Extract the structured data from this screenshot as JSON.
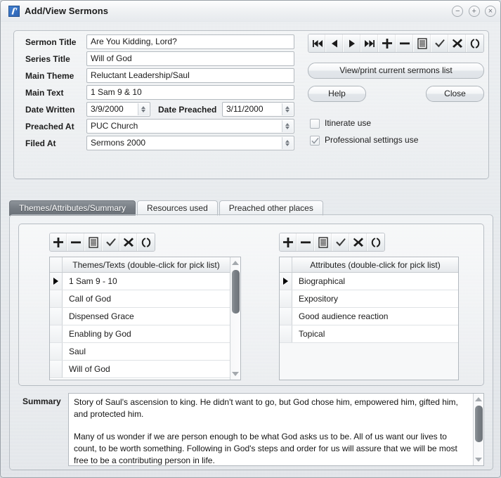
{
  "window": {
    "title": "Add/View Sermons",
    "app_icon": "sermon-app-icon",
    "controls": [
      {
        "name": "minimize-button",
        "glyph": "−"
      },
      {
        "name": "maximize-button",
        "glyph": "+"
      },
      {
        "name": "close-button",
        "glyph": "×"
      }
    ]
  },
  "form": {
    "fields": [
      {
        "label": "Sermon Title",
        "value": "Are You Kidding, Lord?"
      },
      {
        "label": "Series Title",
        "value": "Will of God"
      },
      {
        "label": "Main Theme",
        "value": "Reluctant Leadership/Saul"
      },
      {
        "label": "Main Text",
        "value": "1 Sam 9 & 10"
      }
    ],
    "date_written": {
      "label": "Date Written",
      "value": "3/9/2000"
    },
    "date_preached": {
      "label": "Date Preached",
      "value": "3/11/2000"
    },
    "preached_at": {
      "label": "Preached At",
      "value": "PUC Church"
    },
    "filed_at": {
      "label": "Filed At",
      "value": "Sermons 2000"
    }
  },
  "record_toolbar": {
    "buttons": [
      {
        "name": "first-record-button",
        "icon": "skip-to-start-icon"
      },
      {
        "name": "previous-record-button",
        "icon": "play-left-icon"
      },
      {
        "name": "next-record-button",
        "icon": "play-right-icon"
      },
      {
        "name": "last-record-button",
        "icon": "skip-to-end-icon"
      },
      {
        "name": "insert-record-button",
        "icon": "plus-icon"
      },
      {
        "name": "delete-record-button",
        "icon": "minus-icon"
      },
      {
        "name": "edit-record-button",
        "icon": "document-lines-icon"
      },
      {
        "name": "post-edit-button",
        "icon": "checkmark-icon"
      },
      {
        "name": "cancel-edit-button",
        "icon": "x-cross-icon"
      },
      {
        "name": "refresh-button",
        "icon": "refresh-parens-icon"
      }
    ]
  },
  "actions": {
    "view_print": "View/print current sermons list",
    "help": "Help",
    "close": "Close"
  },
  "checkboxes": [
    {
      "label": "Itinerate use",
      "checked": false
    },
    {
      "label": "Professional settings use",
      "checked": true
    }
  ],
  "tabs": [
    {
      "label": "Themes/Attributes/Summary",
      "active": true
    },
    {
      "label": "Resources used",
      "active": false
    },
    {
      "label": "Preached other places",
      "active": false
    }
  ],
  "themes_grid": {
    "toolbar": [
      {
        "name": "themes-insert-button",
        "icon": "plus-icon"
      },
      {
        "name": "themes-delete-button",
        "icon": "minus-icon"
      },
      {
        "name": "themes-edit-button",
        "icon": "document-lines-icon"
      },
      {
        "name": "themes-post-button",
        "icon": "checkmark-icon"
      },
      {
        "name": "themes-cancel-button",
        "icon": "x-cross-icon"
      },
      {
        "name": "themes-refresh-button",
        "icon": "refresh-parens-icon"
      }
    ],
    "header": "Themes/Texts (double-click for pick list)",
    "rows": [
      {
        "value": "1 Sam 9 - 10",
        "current": true
      },
      {
        "value": "Call of God",
        "current": false
      },
      {
        "value": "Dispensed Grace",
        "current": false
      },
      {
        "value": "Enabling by God",
        "current": false
      },
      {
        "value": "Saul",
        "current": false
      },
      {
        "value": "Will of God",
        "current": false
      }
    ]
  },
  "attributes_grid": {
    "toolbar": [
      {
        "name": "attributes-insert-button",
        "icon": "plus-icon"
      },
      {
        "name": "attributes-delete-button",
        "icon": "minus-icon"
      },
      {
        "name": "attributes-edit-button",
        "icon": "document-lines-icon"
      },
      {
        "name": "attributes-post-button",
        "icon": "checkmark-icon"
      },
      {
        "name": "attributes-cancel-button",
        "icon": "x-cross-icon"
      },
      {
        "name": "attributes-refresh-button",
        "icon": "refresh-parens-icon"
      }
    ],
    "header": "Attributes (double-click for pick list)",
    "rows": [
      {
        "value": "Biographical",
        "current": true
      },
      {
        "value": "Expository",
        "current": false
      },
      {
        "value": "Good audience reaction",
        "current": false
      },
      {
        "value": "Topical",
        "current": false
      }
    ]
  },
  "summary": {
    "label": "Summary",
    "paragraphs": [
      "Story of Saul's ascension to king. He didn't want to go, but God chose him, empowered him, gifted him, and protected him.",
      "Many of us wonder if we are person enough to be what God asks us to be. All of us want our lives to count, to be worth something. Following in God's steps and order for us will assure that we will be most free to be a contributing person in life."
    ]
  },
  "colors": {
    "window_bg": "#e3e7eb",
    "tab_active_bg": "#767c83",
    "field_bg": "#ffffff",
    "border": "#b3b9bf",
    "scroll_thumb": "#787e84"
  }
}
